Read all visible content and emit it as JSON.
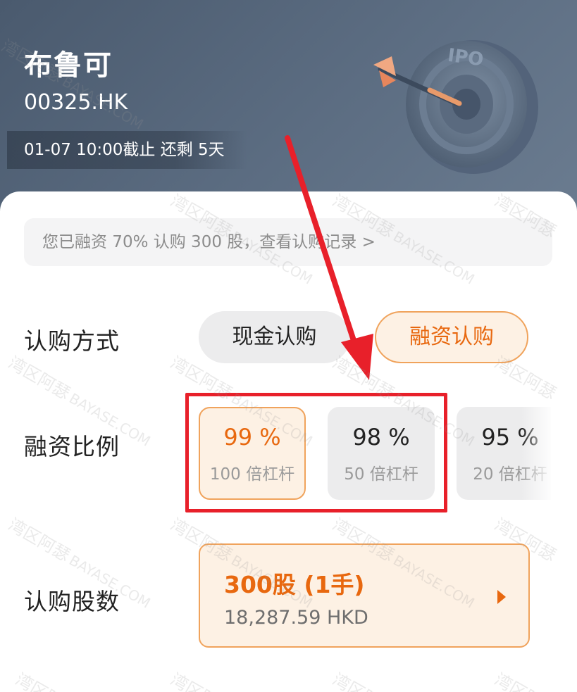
{
  "stock": {
    "name": "布鲁可",
    "code": "00325.HK",
    "deadline": "01-07 10:00截止 还剩 5天"
  },
  "art": {
    "ipo_text": "IPO"
  },
  "notice": {
    "text": "您已融资 70% 认购 300 股，查看认购记录 >"
  },
  "subscription_method": {
    "label": "认购方式",
    "options": [
      "现金认购",
      "融资认购"
    ],
    "selected": "融资认购"
  },
  "financing_ratio": {
    "label": "融资比例",
    "options": [
      {
        "percent": "99 %",
        "leverage": "100 倍杠杆",
        "selected": true
      },
      {
        "percent": "98 %",
        "leverage": "50 倍杠杆",
        "selected": false
      },
      {
        "percent": "95 %",
        "leverage": "20 倍杠杆",
        "selected": false
      }
    ]
  },
  "shares": {
    "label": "认购股数",
    "quantity": "300股 (1手)",
    "amount": "18,287.59 HKD"
  },
  "watermark": {
    "cn": "湾区阿瑟",
    "en": "BAYASE.COM"
  },
  "colors": {
    "accent": "#e8680f",
    "accent_bg": "#fdf1e4",
    "accent_border": "#f0a35c",
    "annotation_red": "#e8202a",
    "header_bg": "#56677b"
  }
}
